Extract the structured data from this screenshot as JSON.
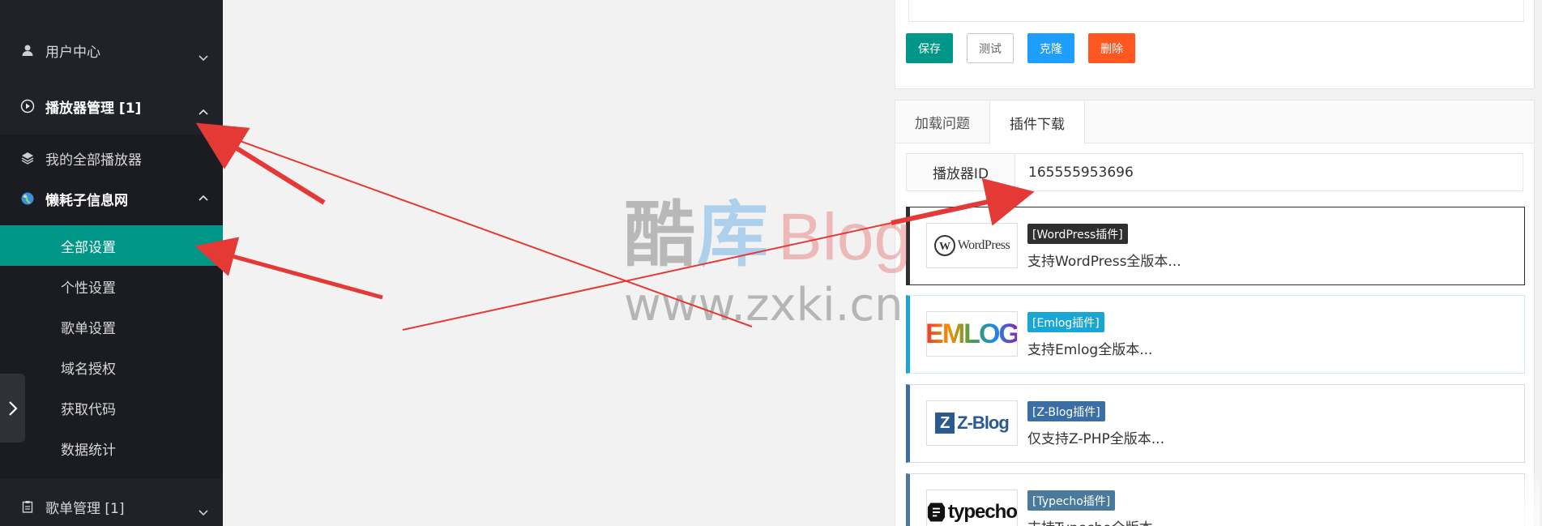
{
  "sidebar": {
    "user_center": "用户中心",
    "player_mgmt": "播放器管理 [1]",
    "my_players": "我的全部播放器",
    "site_name": "懒耗子信息网",
    "sub_items": [
      "全部设置",
      "个性设置",
      "歌单设置",
      "域名授权",
      "获取代码",
      "数据统计"
    ],
    "playlist_mgmt": "歌单管理 [1]"
  },
  "toolbar": {
    "save_label": "保存",
    "test_label": "测试",
    "clone_label": "克隆",
    "delete_label": "删除"
  },
  "tabs": [
    {
      "label": "加载问题"
    },
    {
      "label": "插件下载"
    }
  ],
  "player_id": {
    "label": "播放器ID",
    "value": "165555953696"
  },
  "plugins": [
    {
      "logo_text": "WordPress",
      "tag": "[WordPress插件]",
      "desc": "支持WordPress全版本...",
      "color": "#2f2f2f"
    },
    {
      "logo_text": "EMLOG",
      "tag": "[Emlog插件]",
      "desc": "支持Emlog全版本...",
      "color": "#1aa6d4"
    },
    {
      "logo_text": "Z-Blog",
      "tag": "[Z-Blog插件]",
      "desc": "仅支持Z-PHP全版本...",
      "color": "#3a6ea5"
    },
    {
      "logo_text": "typecho",
      "tag": "[Typecho插件]",
      "desc": "支持Typecho全版本...",
      "color": "#4a7a9b"
    }
  ],
  "watermark": {
    "line1_a": "酷",
    "line1_b": "库",
    "line1_c": "Blog",
    "line2": "www.zxki.cn"
  },
  "colors": {
    "sidebar_bg": "#20222a",
    "accent": "#009688",
    "blue": "#1e9fff",
    "danger": "#ff5722",
    "arrow": "#e53935"
  }
}
